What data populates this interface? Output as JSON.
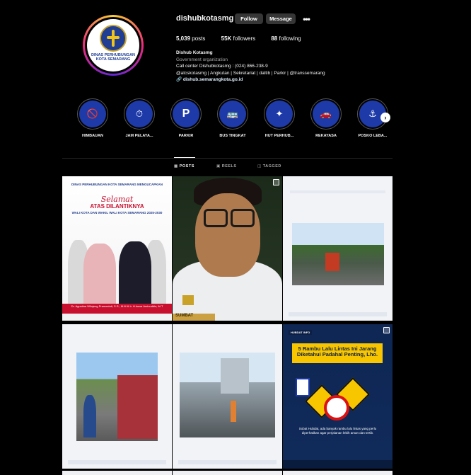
{
  "profile": {
    "username": "dishubkotasmg",
    "follow_label": "Follow",
    "message_label": "Message",
    "more_label": "•••",
    "avatar_text": "DINAS PERHUBUNGAN KOTA SEMARANG",
    "posts_count": "5,039",
    "posts_label": "posts",
    "followers_count": "55K",
    "followers_label": "followers",
    "following_count": "88",
    "following_label": "following",
    "display_name": "Dishub Kotasmg",
    "category": "Government organization",
    "bio_line1": "Call center Dishubkotasmg : (024) 866-238-9",
    "bio_line2": "@atcskotasmg | Angkutan | Sekretariat | daltib | Parkir | @transsemarang",
    "link": "dishub.semarangkota.go.id"
  },
  "highlights": [
    {
      "label": "HIMBAUAN",
      "icon": "🚫"
    },
    {
      "label": "JAM PELAYA...",
      "icon": "⏱"
    },
    {
      "label": "PARKIR",
      "icon": "P"
    },
    {
      "label": "BUS TINGKAT",
      "icon": "🚌"
    },
    {
      "label": "HUT PERHUB...",
      "icon": "✦"
    },
    {
      "label": "REKAYASA",
      "icon": "🚗"
    },
    {
      "label": "POSKO LEBA...",
      "icon": "⚓"
    }
  ],
  "tabs": {
    "posts": "POSTS",
    "reels": "REELS",
    "tagged": "TAGGED"
  },
  "posts": {
    "p1": {
      "header": "DINAS PERHUBUNGAN KOTA SEMARANG MENGUCAPKAN",
      "script": "Selamat",
      "title": "ATAS DILANTIKNYA",
      "subtitle": "WALI KOTA DAN WAKIL WALI KOTA SEMARANG 2025-2030",
      "names": "Dr. Agustina Wilujeng Pramestuti, S.S., M.M & Ir. H.Iswar Aminuddin, M.T"
    },
    "p2": {
      "plate": "SUMBAT"
    },
    "p6": {
      "tag": "HUBDAT INFO",
      "title": "5 Rambu Lalu Lintas Ini Jarang Diketahui Padahal Penting, Lho.",
      "desc": "Sobat Hubdat, ada banyak rambu lalu lintas yang perlu diperhatikan agar perjalanan lebih aman dan tertib."
    }
  }
}
